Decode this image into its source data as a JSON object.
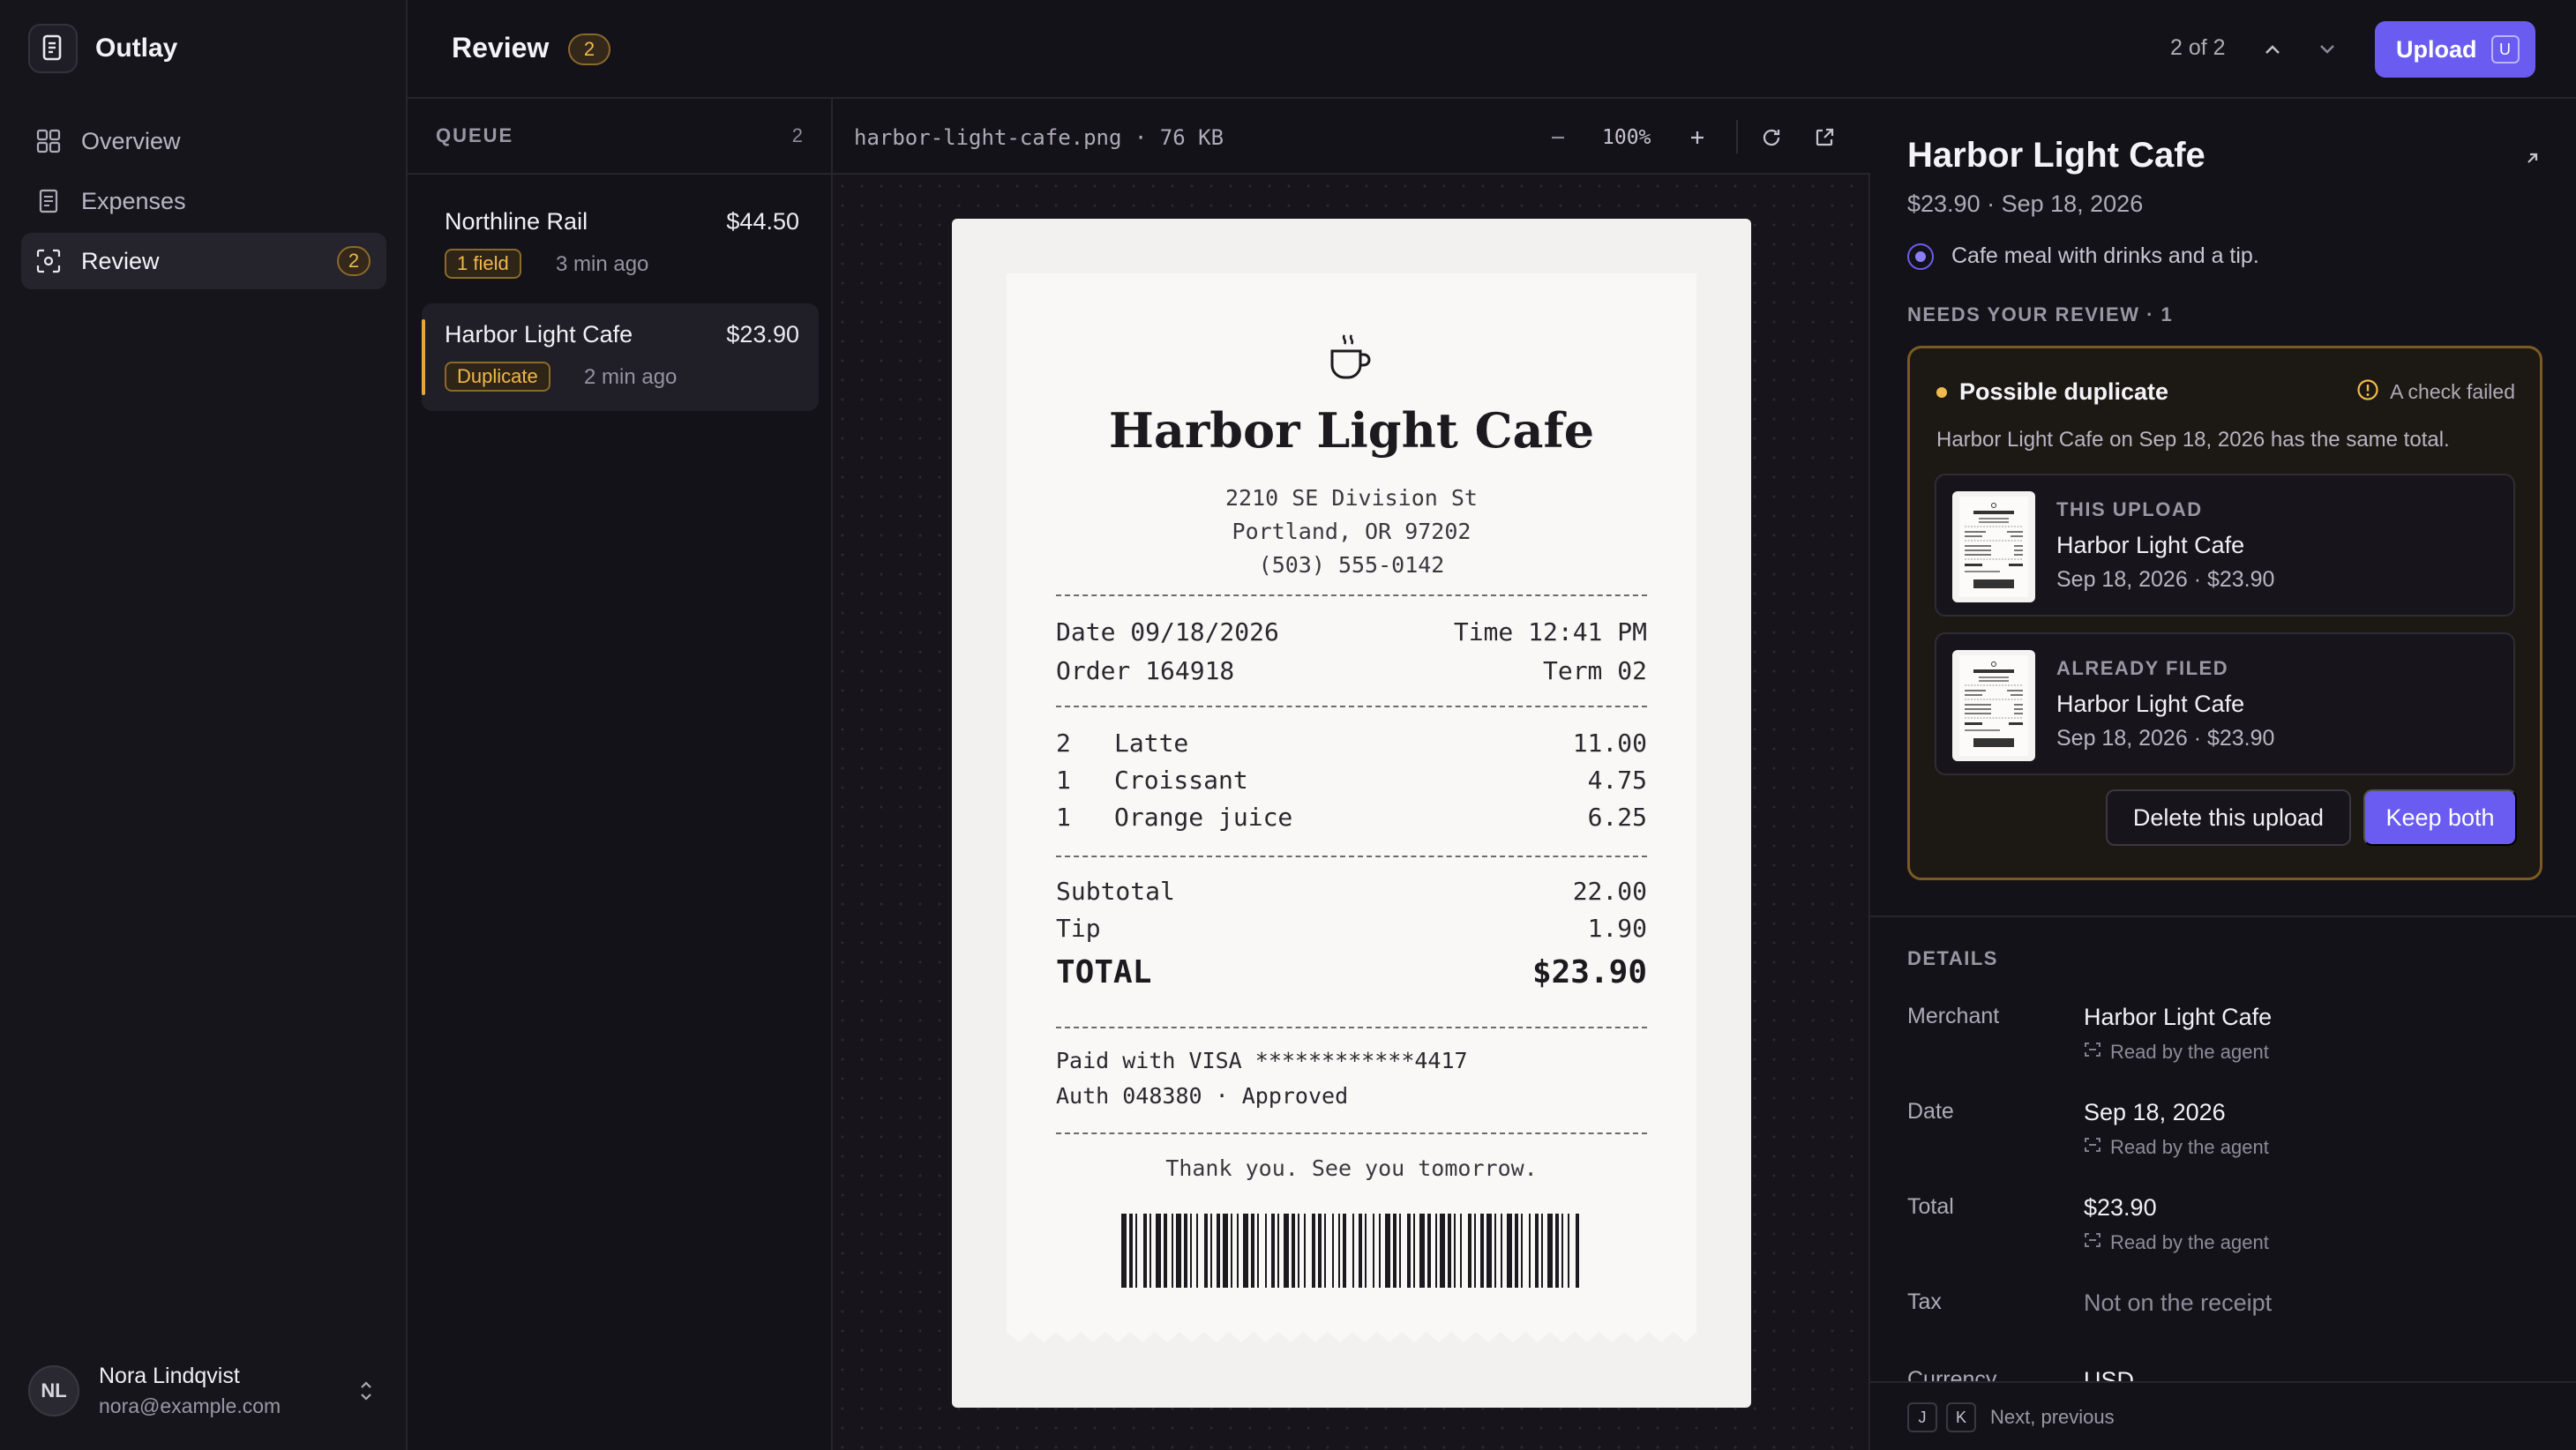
{
  "app": {
    "name": "Outlay",
    "logo_icon": "receipt-icon"
  },
  "sidebar": {
    "items": [
      {
        "label": "Overview",
        "icon": "grid-icon"
      },
      {
        "label": "Expenses",
        "icon": "document-icon"
      },
      {
        "label": "Review",
        "icon": "scan-icon",
        "badge": "2",
        "active": true
      }
    ],
    "user": {
      "initials": "NL",
      "name": "Nora Lindqvist",
      "email": "nora@example.com"
    }
  },
  "header": {
    "title": "Review",
    "badge": "2",
    "pager": "2 of 2",
    "upload_label": "Upload",
    "upload_shortcut": "U"
  },
  "queue": {
    "title": "QUEUE",
    "count": "2",
    "items": [
      {
        "name": "Northline Rail",
        "amount": "$44.50",
        "tag": "1 field",
        "time": "3 min ago"
      },
      {
        "name": "Harbor Light Cafe",
        "amount": "$23.90",
        "tag": "Duplicate",
        "time": "2 min ago",
        "selected": true
      }
    ]
  },
  "viewer": {
    "file_label": "harbor-light-cafe.png · 76 KB",
    "zoom": "100%",
    "receipt": {
      "merchant": "Harbor Light Cafe",
      "address1": "2210 SE Division St",
      "address2": "Portland, OR 97202",
      "phone": "(503) 555-0142",
      "date": "Date 09/18/2026",
      "time": "Time 12:41 PM",
      "order": "Order 164918",
      "term": "Term 02",
      "items": [
        {
          "qty": "2",
          "name": "Latte",
          "price": "11.00"
        },
        {
          "qty": "1",
          "name": "Croissant",
          "price": "4.75"
        },
        {
          "qty": "1",
          "name": "Orange juice",
          "price": "6.25"
        }
      ],
      "subtotal_label": "Subtotal",
      "subtotal": "22.00",
      "tip_label": "Tip",
      "tip": "1.90",
      "total_label": "TOTAL",
      "total": "$23.90",
      "payment": "Paid with VISA ************4417",
      "auth": "Auth 048380 · Approved",
      "thanks": "Thank you. See you tomorrow."
    }
  },
  "detail": {
    "title": "Harbor Light Cafe",
    "subtitle": "$23.90 · Sep 18, 2026",
    "description": "Cafe meal with drinks and a tip.",
    "review_label": "NEEDS YOUR REVIEW · 1",
    "duplicate": {
      "title": "Possible duplicate",
      "check_label": "A check failed",
      "text": "Harbor Light Cafe on Sep 18, 2026 has the same total.",
      "this_upload": {
        "kicker": "THIS UPLOAD",
        "name": "Harbor Light Cafe",
        "meta": "Sep 18, 2026 · $23.90"
      },
      "already_filed": {
        "kicker": "ALREADY FILED",
        "name": "Harbor Light Cafe",
        "meta": "Sep 18, 2026 · $23.90"
      },
      "delete_label": "Delete this upload",
      "keep_label": "Keep both"
    },
    "details_label": "DETAILS",
    "fields": [
      {
        "label": "Merchant",
        "value": "Harbor Light Cafe",
        "source": "Read by the agent"
      },
      {
        "label": "Date",
        "value": "Sep 18, 2026",
        "source": "Read by the agent"
      },
      {
        "label": "Total",
        "value": "$23.90",
        "source": "Read by the agent"
      },
      {
        "label": "Tax",
        "value": "Not on the receipt"
      },
      {
        "label": "Currency",
        "value": "USD"
      }
    ],
    "footer": {
      "key1": "J",
      "key2": "K",
      "hint": "Next, previous"
    }
  },
  "colors": {
    "accent": "#6a5cf0",
    "warning": "#f0b84e",
    "background": "#141219"
  }
}
